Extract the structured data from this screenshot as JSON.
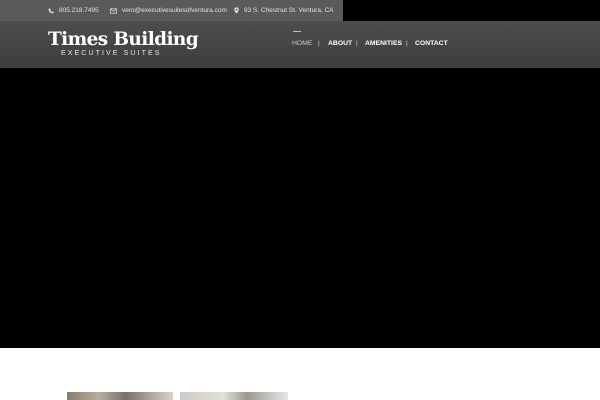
{
  "topbar": {
    "phone": "805.218.7495",
    "email": "vero@executivesuitesofventura.com",
    "address": "93 S. Chestnut St. Ventura, CA",
    "icons": [
      "phone-icon",
      "mail-icon",
      "map-pin-icon"
    ]
  },
  "logo": {
    "title": "Times Building",
    "subtitle": "EXECUTIVE SUITES"
  },
  "nav": {
    "items": [
      {
        "label": "HOME",
        "active": true
      },
      {
        "label": "ABOUT",
        "active": false
      },
      {
        "label": "AMENITIES",
        "active": false
      },
      {
        "label": "CONTACT",
        "active": false
      }
    ],
    "separator": "|"
  },
  "colors": {
    "topbar_bg": "#5a5a5a",
    "header_bg": "#444444",
    "hero_bg": "#000000",
    "nav_text": "#ffffff",
    "nav_active": "#c9c9c9"
  }
}
